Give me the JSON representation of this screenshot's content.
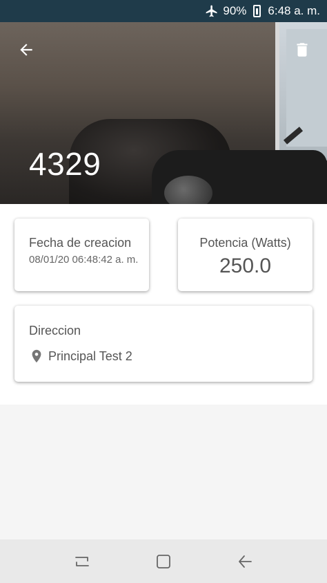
{
  "status_bar": {
    "battery": "90%",
    "time": "6:48 a. m.",
    "icons": [
      "airplane-icon",
      "battery-icon"
    ]
  },
  "header": {
    "title": "4329",
    "back_icon": "arrow-left-icon",
    "delete_icon": "trash-icon"
  },
  "cards": {
    "fecha": {
      "label": "Fecha de creacion",
      "value": "08/01/20 06:48:42 a. m."
    },
    "potencia": {
      "label": "Potencia (Watts)",
      "value": "250.0"
    },
    "direccion": {
      "label": "Direccion",
      "value": "Principal Test 2",
      "icon": "location-pin-icon"
    }
  },
  "nav_bar": {
    "icons": [
      "recent-apps-icon",
      "home-icon",
      "back-icon"
    ]
  },
  "colors": {
    "status_bar": "#1f3b4a",
    "text": "#555555",
    "nav_bar": "#e9e9e9"
  }
}
